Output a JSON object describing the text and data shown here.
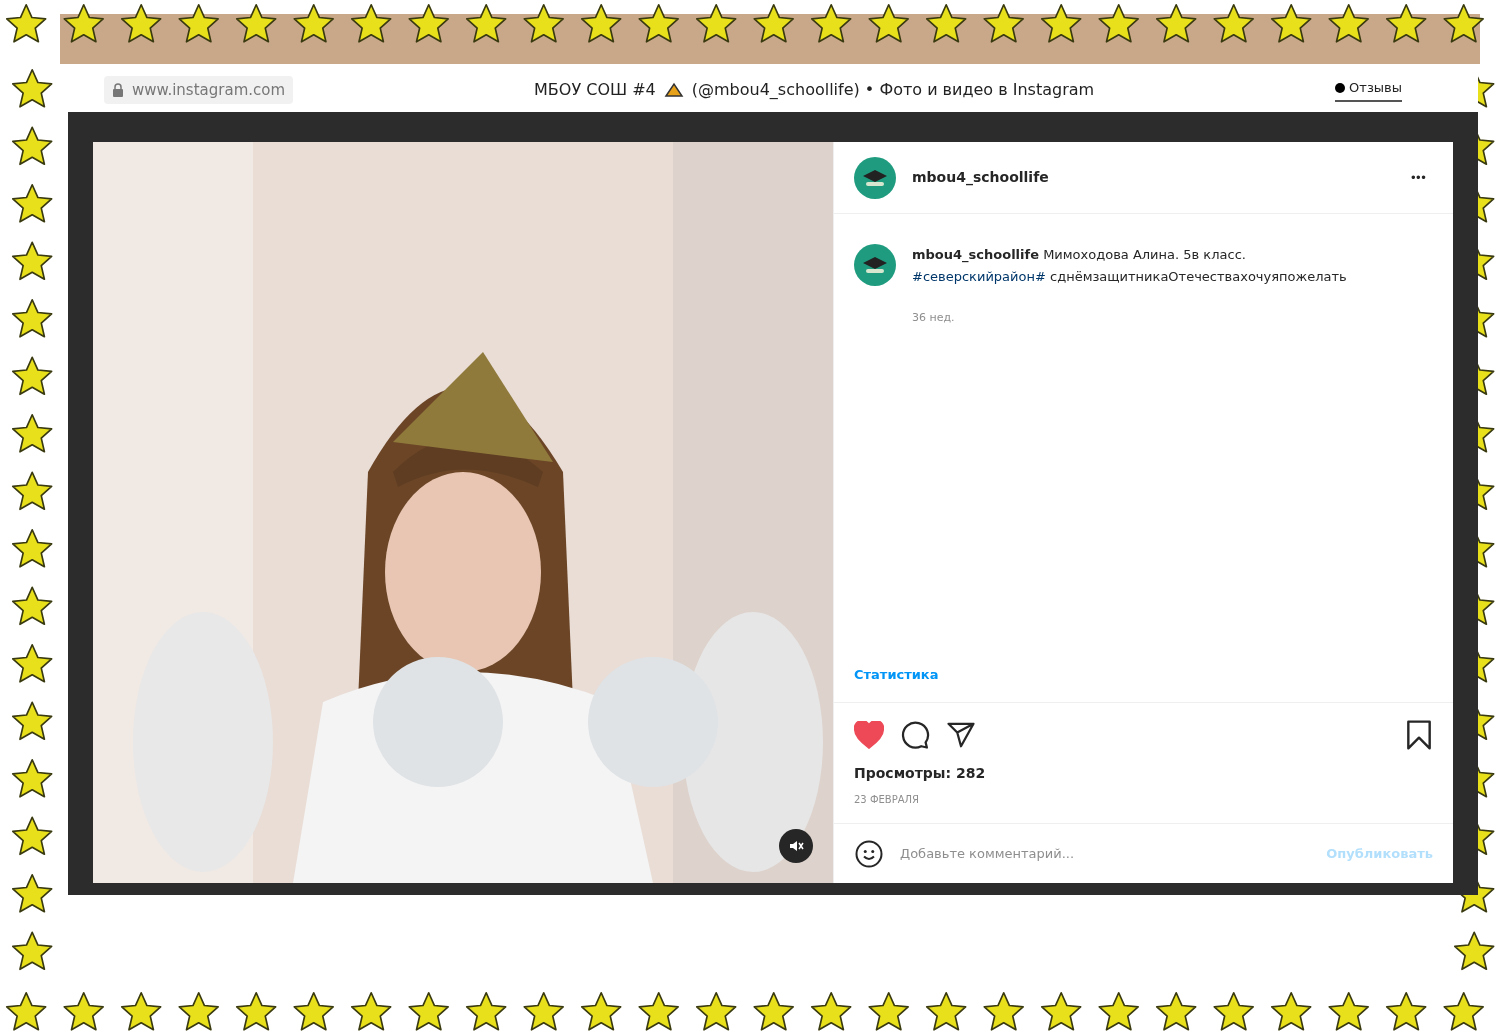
{
  "browser": {
    "url": "www.instagram.com",
    "title_start": "МБОУ СОШ #4",
    "title_end": "(@mbou4_schoollife) • Фото и видео в Instagram",
    "feedback": "Отзывы"
  },
  "post": {
    "media": {
      "kind": "picture",
      "muted": true
    },
    "header": {
      "username": "mbou4_schoollife",
      "more": "•••"
    },
    "caption": {
      "username": "mbou4_schoollife",
      "text": "Мимоходова Алина. 5в класс.",
      "hashtag": "#северскийрайон#",
      "text_end": "сднёмзащитникаОтечествахочуяпожелать",
      "age": "36 нед."
    },
    "statistics": "Статистика",
    "liked": true,
    "views": "Просмотры: 282",
    "date": "23 ФЕВРАЛЯ",
    "comment": {
      "placeholder": "Добавьте комментарий...",
      "submit": "Опубликовать"
    }
  }
}
